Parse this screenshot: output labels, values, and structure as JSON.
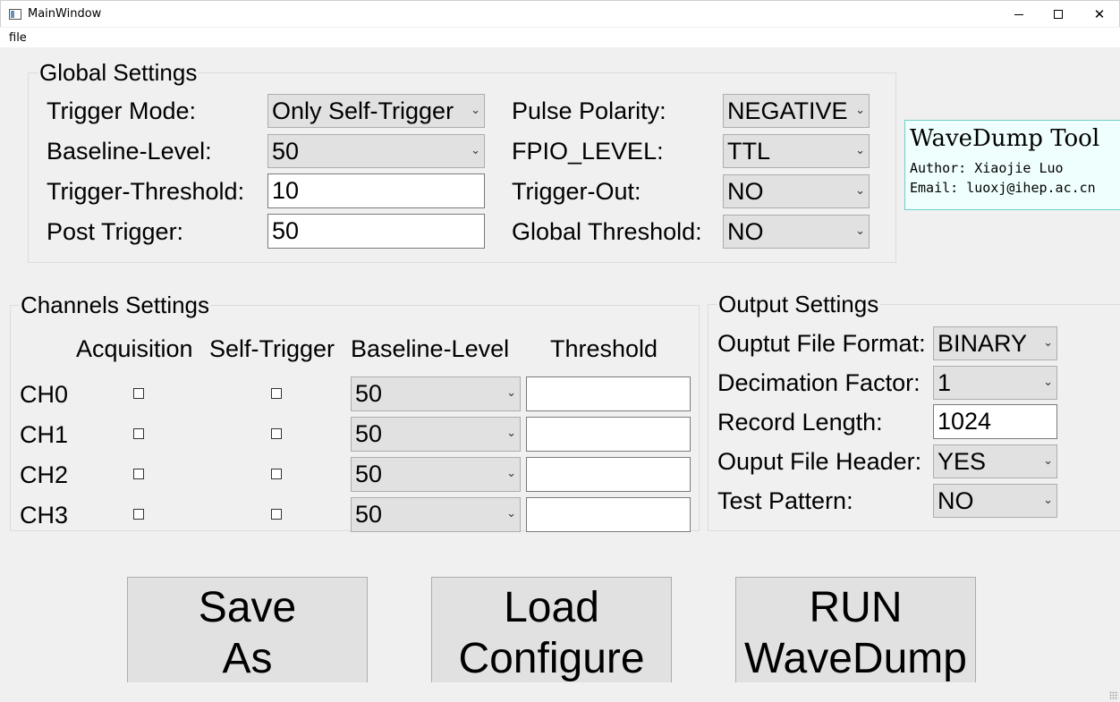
{
  "window": {
    "title": "MainWindow",
    "minimize": "",
    "maximize": "",
    "close": "✕"
  },
  "menu": {
    "file": "file"
  },
  "global": {
    "title": "Global Settings",
    "trigger_mode_label": "Trigger Mode:",
    "trigger_mode_value": "Only Self-Trigger",
    "baseline_label": "Baseline-Level:",
    "baseline_value": "50",
    "trigger_threshold_label": "Trigger-Threshold:",
    "trigger_threshold_value": "10",
    "post_trigger_label": "Post Trigger:",
    "post_trigger_value": "50",
    "pulse_polarity_label": "Pulse Polarity:",
    "pulse_polarity_value": "NEGATIVE",
    "fpio_label": "FPIO_LEVEL:",
    "fpio_value": "TTL",
    "trigger_out_label": "Trigger-Out:",
    "trigger_out_value": "NO",
    "global_threshold_label": "Global Threshold:",
    "global_threshold_value": "NO"
  },
  "info": {
    "title": "WaveDump Tool",
    "author": "Author: Xiaojie Luo",
    "email": "Email: luoxj@ihep.ac.cn"
  },
  "channels": {
    "title": "Channels Settings",
    "headers": [
      "Acquisition",
      "Self-Trigger",
      "Baseline-Level",
      "Threshold"
    ],
    "rows": [
      {
        "name": "CH0",
        "acquisition": false,
        "self_trigger": false,
        "baseline": "50",
        "threshold": ""
      },
      {
        "name": "CH1",
        "acquisition": false,
        "self_trigger": false,
        "baseline": "50",
        "threshold": ""
      },
      {
        "name": "CH2",
        "acquisition": false,
        "self_trigger": false,
        "baseline": "50",
        "threshold": ""
      },
      {
        "name": "CH3",
        "acquisition": false,
        "self_trigger": false,
        "baseline": "50",
        "threshold": ""
      }
    ]
  },
  "output": {
    "title": "Output Settings",
    "format_label": "Ouptut File Format:",
    "format_value": "BINARY",
    "decimation_label": "Decimation Factor:",
    "decimation_value": "1",
    "record_length_label": "Record Length:",
    "record_length_value": "1024",
    "header_label": "Ouput File Header:",
    "header_value": "YES",
    "test_pattern_label": "Test Pattern:",
    "test_pattern_value": "NO"
  },
  "buttons": {
    "save": [
      "Save",
      "As"
    ],
    "load": [
      "Load",
      "Configure"
    ],
    "run": [
      "RUN",
      "WaveDump"
    ]
  }
}
